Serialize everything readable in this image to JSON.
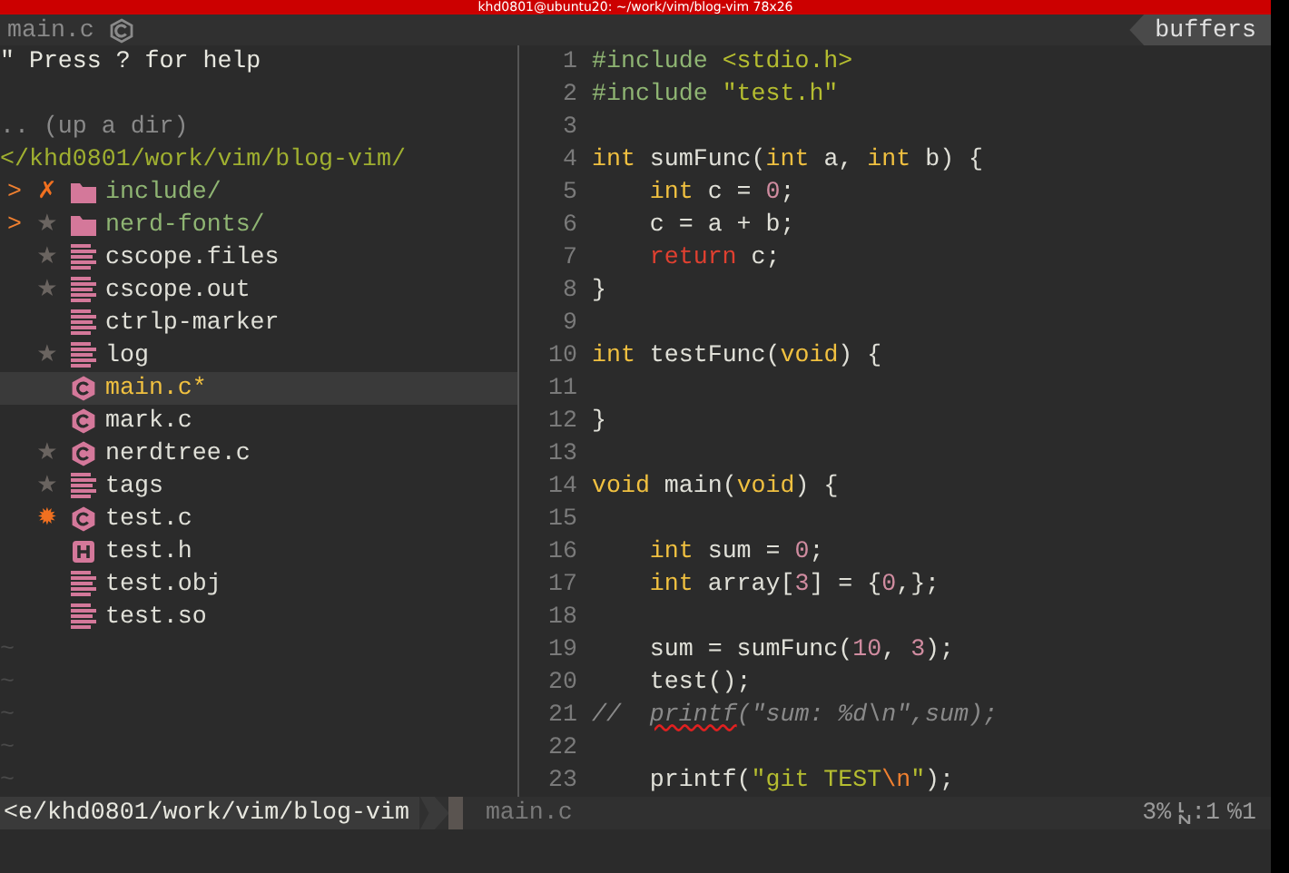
{
  "window": {
    "title": "khd0801@ubuntu20: ~/work/vim/blog-vim 78x26"
  },
  "tabline": {
    "buffer_name": "main.c",
    "buffers_label": "buffers"
  },
  "tree": {
    "help": "\" Press ? for help",
    "up_dir": ".. (up a dir)",
    "root": "</khd0801/work/vim/blog-vim/",
    "items": [
      {
        "name": "include/",
        "kind": "folder",
        "arrow": ">",
        "git": {
          "symbol": "✗",
          "color": "#f07020"
        },
        "selected": false
      },
      {
        "name": "nerd-fonts/",
        "kind": "folder",
        "arrow": ">",
        "git": {
          "symbol": "★",
          "color": "#6a6460"
        },
        "selected": false
      },
      {
        "name": "cscope.files",
        "kind": "text",
        "git": {
          "symbol": "★",
          "color": "#6a6460"
        },
        "selected": false
      },
      {
        "name": "cscope.out",
        "kind": "text",
        "git": {
          "symbol": "★",
          "color": "#6a6460"
        },
        "selected": false
      },
      {
        "name": "ctrlp-marker",
        "kind": "text",
        "selected": false
      },
      {
        "name": "log",
        "kind": "text",
        "git": {
          "symbol": "★",
          "color": "#6a6460"
        },
        "selected": false
      },
      {
        "name": "main.c*",
        "kind": "c",
        "selected": true
      },
      {
        "name": "mark.c",
        "kind": "c",
        "selected": false
      },
      {
        "name": "nerdtree.c",
        "kind": "c",
        "git": {
          "symbol": "★",
          "color": "#6a6460"
        },
        "selected": false
      },
      {
        "name": "tags",
        "kind": "text",
        "git": {
          "symbol": "★",
          "color": "#6a6460"
        },
        "selected": false
      },
      {
        "name": "test.c",
        "kind": "c",
        "git": {
          "symbol": "✹",
          "color": "#f07020"
        },
        "selected": false
      },
      {
        "name": "test.h",
        "kind": "h",
        "selected": false
      },
      {
        "name": "test.obj",
        "kind": "text",
        "selected": false
      },
      {
        "name": "test.so",
        "kind": "text",
        "selected": false
      }
    ],
    "filler": [
      "~",
      "~",
      "~",
      "~",
      "~"
    ]
  },
  "code": [
    {
      "number": "1",
      "tokens": [
        {
          "kind": "pre",
          "text": "#include "
        },
        {
          "kind": "str",
          "text": "<stdio.h>"
        }
      ]
    },
    {
      "number": "2",
      "tokens": [
        {
          "kind": "pre",
          "text": "#include "
        },
        {
          "kind": "str",
          "text": "\"test.h\""
        }
      ]
    },
    {
      "number": "3"
    },
    {
      "number": "4",
      "tokens": [
        {
          "kind": "type",
          "text": "int"
        },
        {
          "kind": "plain",
          "text": " sumFunc("
        },
        {
          "kind": "type",
          "text": "int"
        },
        {
          "kind": "plain",
          "text": " a, "
        },
        {
          "kind": "type",
          "text": "int"
        },
        {
          "kind": "plain",
          "text": " b) {"
        }
      ]
    },
    {
      "number": "5",
      "indented": true,
      "tokens": [
        {
          "kind": "type",
          "text": "int"
        },
        {
          "kind": "plain",
          "text": " c = "
        },
        {
          "kind": "num",
          "text": "0"
        },
        {
          "kind": "plain",
          "text": ";"
        }
      ]
    },
    {
      "number": "6",
      "indented": true,
      "tokens": [
        {
          "kind": "plain",
          "text": "c = a + b;"
        }
      ]
    },
    {
      "number": "7",
      "indented": true,
      "tokens": [
        {
          "kind": "ret",
          "text": "return"
        },
        {
          "kind": "plain",
          "text": " c;"
        }
      ]
    },
    {
      "number": "8",
      "tokens": [
        {
          "kind": "plain",
          "text": "}"
        }
      ]
    },
    {
      "number": "9"
    },
    {
      "number": "10",
      "tokens": [
        {
          "kind": "type",
          "text": "int"
        },
        {
          "kind": "plain",
          "text": " testFunc("
        },
        {
          "kind": "type",
          "text": "void"
        },
        {
          "kind": "plain",
          "text": ") {"
        }
      ]
    },
    {
      "number": "11"
    },
    {
      "number": "12",
      "tokens": [
        {
          "kind": "plain",
          "text": "}"
        }
      ]
    },
    {
      "number": "13"
    },
    {
      "number": "14",
      "tokens": [
        {
          "kind": "type",
          "text": "void"
        },
        {
          "kind": "plain",
          "text": " main("
        },
        {
          "kind": "type",
          "text": "void"
        },
        {
          "kind": "plain",
          "text": ") {"
        }
      ]
    },
    {
      "number": "15"
    },
    {
      "number": "16",
      "indented": true,
      "tokens": [
        {
          "kind": "type",
          "text": "int"
        },
        {
          "kind": "plain",
          "text": " sum = "
        },
        {
          "kind": "num",
          "text": "0"
        },
        {
          "kind": "plain",
          "text": ";"
        }
      ]
    },
    {
      "number": "17",
      "indented": true,
      "tokens": [
        {
          "kind": "type",
          "text": "int"
        },
        {
          "kind": "plain",
          "text": " array["
        },
        {
          "kind": "num",
          "text": "3"
        },
        {
          "kind": "plain",
          "text": "] = {"
        },
        {
          "kind": "num",
          "text": "0"
        },
        {
          "kind": "plain",
          "text": ",};"
        }
      ]
    },
    {
      "number": "18"
    },
    {
      "number": "19",
      "indented": true,
      "tokens": [
        {
          "kind": "plain",
          "text": "sum = sumFunc("
        },
        {
          "kind": "num",
          "text": "10"
        },
        {
          "kind": "plain",
          "text": ", "
        },
        {
          "kind": "num",
          "text": "3"
        },
        {
          "kind": "plain",
          "text": ");"
        }
      ]
    },
    {
      "number": "20",
      "indented": true,
      "tokens": [
        {
          "kind": "plain",
          "text": "test();"
        }
      ]
    },
    {
      "number": "21",
      "tokens": [
        {
          "kind": "comment",
          "text": "//  "
        },
        {
          "kind": "spell",
          "text": "printf"
        },
        {
          "kind": "comment",
          "text": "(\"sum: %d\\n\",sum);"
        }
      ]
    },
    {
      "number": "22"
    },
    {
      "number": "23",
      "indented": true,
      "tokens": [
        {
          "kind": "plain",
          "text": "printf("
        },
        {
          "kind": "str",
          "text": "\"git TEST"
        },
        {
          "kind": "esc",
          "text": "\\n"
        },
        {
          "kind": "str",
          "text": "\""
        },
        {
          "kind": "plain",
          "text": ");"
        }
      ]
    }
  ],
  "statusline": {
    "path": "<e/khd0801/work/vim/blog-vim",
    "file": "main.c",
    "percent": "3%",
    "line": ":1",
    "column": "℅1"
  }
}
